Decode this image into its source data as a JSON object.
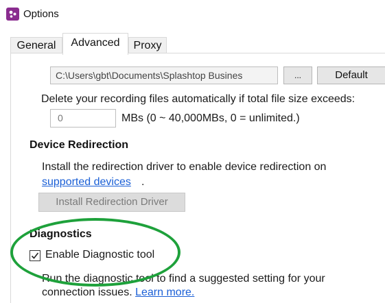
{
  "window": {
    "title": "Options"
  },
  "tabs": {
    "general": "General",
    "advanced": "Advanced",
    "proxy": "Proxy"
  },
  "recording": {
    "path_value": "C:\\Users\\gbt\\Documents\\Splashtop Busines",
    "browse_label": "...",
    "default_label": "Default",
    "delete_label": "Delete your recording files automatically if total file size exceeds:",
    "size_value": "0",
    "size_unit_label": "MBs (0 ~ 40,000MBs, 0 = unlimited.)"
  },
  "device_redirection": {
    "heading": "Device Redirection",
    "install_text": "Install the redirection driver to enable device redirection on",
    "supported_link": "supported devices",
    "period": ".",
    "install_button": "Install Redirection Driver"
  },
  "diagnostics": {
    "heading": "Diagnostics",
    "checkbox_label": "Enable Diagnostic tool",
    "checked": true,
    "run_text": "Run the diagnostic tool to find a suggested setting for your",
    "conn_text": "connection issues.",
    "learn_more": "Learn more."
  },
  "colors": {
    "accent_link": "#1a5fd6",
    "highlight": "#1ea13b",
    "app_icon": "#8a2c8f"
  }
}
